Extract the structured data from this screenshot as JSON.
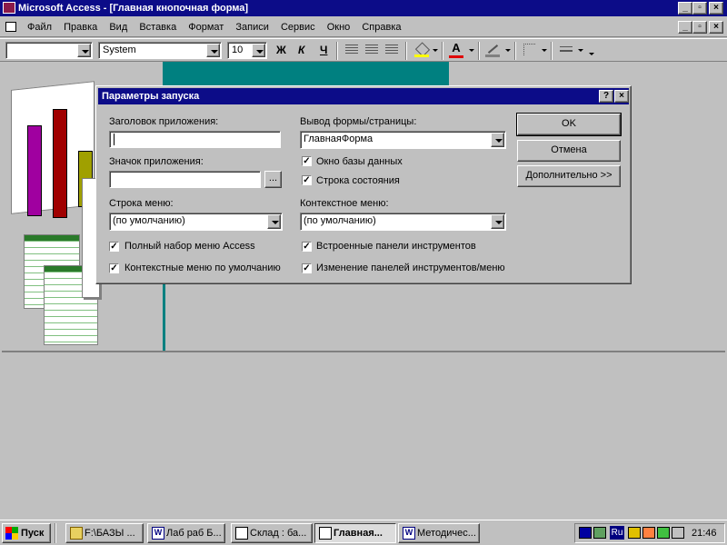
{
  "app": {
    "title": "Microsoft Access - [Главная кнопочная форма]"
  },
  "menu": {
    "items": [
      "Файл",
      "Правка",
      "Вид",
      "Вставка",
      "Формат",
      "Записи",
      "Сервис",
      "Окно",
      "Справка"
    ]
  },
  "toolbar": {
    "object_combo": "",
    "font_combo": "System",
    "size_combo": "10",
    "bold": "Ж",
    "italic": "К",
    "underline": "Ч"
  },
  "dialog": {
    "title": "Параметры запуска",
    "help": "?",
    "close": "×",
    "app_title_label": "Заголовок приложения:",
    "app_title_value": "",
    "app_icon_label": "Значок приложения:",
    "app_icon_value": "",
    "browse_label": "...",
    "menu_bar_label": "Строка меню:",
    "menu_bar_value": "(по умолчанию)",
    "full_menus_label": "Полный набор меню Access",
    "default_context_label": "Контекстные меню по умолчанию",
    "display_form_label": "Вывод формы/страницы:",
    "display_form_value": "ГлавнаяФорма",
    "db_window_label": "Окно базы данных",
    "status_bar_label": "Строка состояния",
    "shortcut_menu_label": "Контекстное меню:",
    "shortcut_menu_value": "(по умолчанию)",
    "builtin_toolbars_label": "Встроенные панели инструментов",
    "toolbar_changes_label": "Изменение панелей инструментов/меню",
    "ok_label": "OK",
    "cancel_label": "Отмена",
    "advanced_label": "Дополнительно >>",
    "checked": {
      "full_menus": true,
      "default_context": true,
      "db_window": true,
      "status_bar": true,
      "builtin_toolbars": true,
      "toolbar_changes": true
    }
  },
  "taskbar": {
    "start": "Пуск",
    "tasks": [
      "F:\\БАЗЫ ...",
      "Лаб раб Б...",
      "Склад : ба...",
      "Главная...",
      "Методичес..."
    ],
    "lang": "Ru",
    "clock": "21:46"
  },
  "colors": {
    "caption": "#0c0c88",
    "teal": "#008080",
    "face": "#c0c0c0"
  }
}
